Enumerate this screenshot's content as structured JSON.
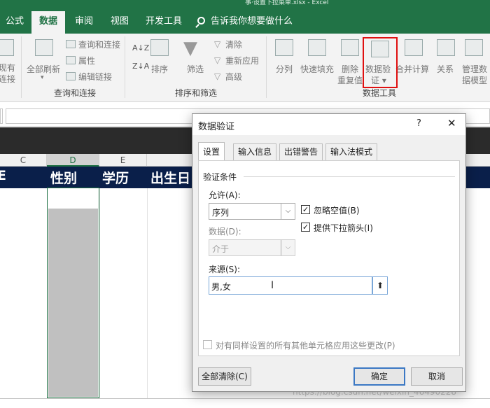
{
  "window": {
    "title_fragment": "事·设置下拉菜单.xlsx - Excel"
  },
  "tabs": [
    {
      "label": "公式",
      "active": false
    },
    {
      "label": "数据",
      "active": true
    },
    {
      "label": "审阅",
      "active": false
    },
    {
      "label": "视图",
      "active": false
    },
    {
      "label": "开发工具",
      "active": false
    }
  ],
  "tell_me": "告诉我你想要做什么",
  "ribbon": {
    "get_data": {
      "line1": "现有",
      "line2": "连接"
    },
    "refresh_all": {
      "line1": "全部刷新"
    },
    "queries_connections": "查询和连接",
    "properties": "属性",
    "edit_links": "编辑链接",
    "group_queries": "查询和连接",
    "sort_az": "A↓Z",
    "sort_za": "Z↓A",
    "sort": "排序",
    "filter": "筛选",
    "clear": "清除",
    "reapply": "重新应用",
    "advanced": "高级",
    "group_sort": "排序和筛选",
    "split": "分列",
    "flash_fill": "快速填充",
    "remove_dup": {
      "line1": "删除",
      "line2": "重复值"
    },
    "data_validation": {
      "line1": "数据验",
      "line2": "证 ▾"
    },
    "consolidate": "合并计算",
    "relations": "关系",
    "data_model": {
      "line1": "管理数",
      "line2": "据模型"
    },
    "group_tools": "数据工具"
  },
  "sheet": {
    "columns": [
      "C",
      "D",
      "E"
    ],
    "header_cells": [
      "性别",
      "学历",
      "出生日"
    ],
    "partial_left": "C"
  },
  "dialog": {
    "title": "数据验证",
    "help": "?",
    "close": "✕",
    "tabs": [
      "设置",
      "输入信息",
      "出错警告",
      "输入法模式"
    ],
    "section": "验证条件",
    "allow_label": "允许(A):",
    "allow_value": "序列",
    "data_label": "数据(D):",
    "data_value": "介于",
    "ignore_blank": {
      "label": "忽略空值(B)",
      "checked": true
    },
    "dropdown": {
      "label": "提供下拉箭头(I)",
      "checked": true
    },
    "source_label": "来源(S):",
    "source_value": "男,女",
    "apply_all": {
      "label": "对有同样设置的所有其他单元格应用这些更改(P)",
      "checked": false
    },
    "clear_all": "全部清除(C)",
    "ok": "确定",
    "cancel": "取消"
  },
  "watermark": "https://blog.csdn.net/weixin_46490228"
}
